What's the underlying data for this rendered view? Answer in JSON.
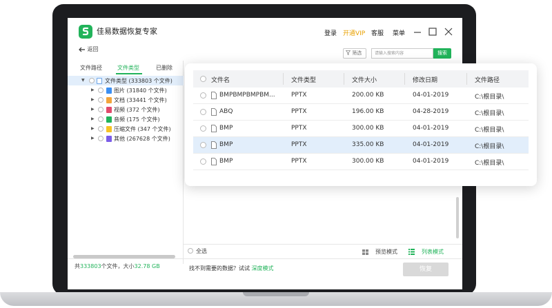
{
  "app": {
    "title": "佳易数据恢复专家",
    "login": "登录",
    "vip": "开通VIP",
    "service": "客服",
    "menu": "菜单"
  },
  "toolbar": {
    "back": "返回",
    "filter": "筛选",
    "search_placeholder": "请输入搜索内容",
    "search_button": "搜索"
  },
  "left_tabs": [
    {
      "label": "文件路径",
      "active": false
    },
    {
      "label": "文件类型",
      "active": true
    },
    {
      "label": "已删除",
      "active": false
    }
  ],
  "tree": {
    "root": "文件类型 (333803 个文件)",
    "items": [
      {
        "label": "图片 (31840 个文件)",
        "icon": "image-icon",
        "color": "#3b8ff2"
      },
      {
        "label": "文档 (33441 个文件)",
        "icon": "document-icon",
        "color": "#f3a53b"
      },
      {
        "label": "视频 (372 个文件)",
        "icon": "video-icon",
        "color": "#e24a6c"
      },
      {
        "label": "音频 (175 个文件)",
        "icon": "audio-icon",
        "color": "#21b35a"
      },
      {
        "label": "压缩文件 (347 个文件)",
        "icon": "archive-icon",
        "color": "#f7c325"
      },
      {
        "label": "其他 (267628 个文件)",
        "icon": "other-icon",
        "color": "#7b5de8"
      }
    ]
  },
  "table": {
    "columns": [
      "文件名",
      "文件类型",
      "文件大小",
      "修改日期",
      "文件路径"
    ],
    "rows": [
      {
        "name": "BMPBMPBMPBM...",
        "type": "PPTX",
        "size": "200.00 KB",
        "date": "04-01-2019",
        "path": "C:\\根目录\\",
        "selected": false
      },
      {
        "name": "ABQ",
        "type": "PPTX",
        "size": "196.00 KB",
        "date": "04-28-2019",
        "path": "C:\\根目录\\",
        "selected": false
      },
      {
        "name": "BMP",
        "type": "PPTX",
        "size": "300.00 KB",
        "date": "04-01-2019",
        "path": "C:\\根目录\\",
        "selected": false
      },
      {
        "name": "BMP",
        "type": "PPTX",
        "size": "335.00 KB",
        "date": "04-01-2019",
        "path": "C:\\根目录\\",
        "selected": true
      },
      {
        "name": "BMP",
        "type": "PPTX",
        "size": "300.00 KB",
        "date": "04-01-2019",
        "path": "C:\\根目录\\",
        "selected": false
      }
    ]
  },
  "bottom": {
    "select_all": "全选",
    "preview_mode": "预览模式",
    "list_mode": "列表模式"
  },
  "footer": {
    "prefix": "共",
    "count": "333803",
    "mid": "个文件，大小",
    "size": "32.78 GB",
    "help_text": "找不到需要的数据？试试",
    "deep_mode": "深度模式",
    "recover": "恢复"
  },
  "colors": {
    "accent": "#21b35a",
    "vip": "#e8a000",
    "selected_row": "#e2eefb"
  }
}
